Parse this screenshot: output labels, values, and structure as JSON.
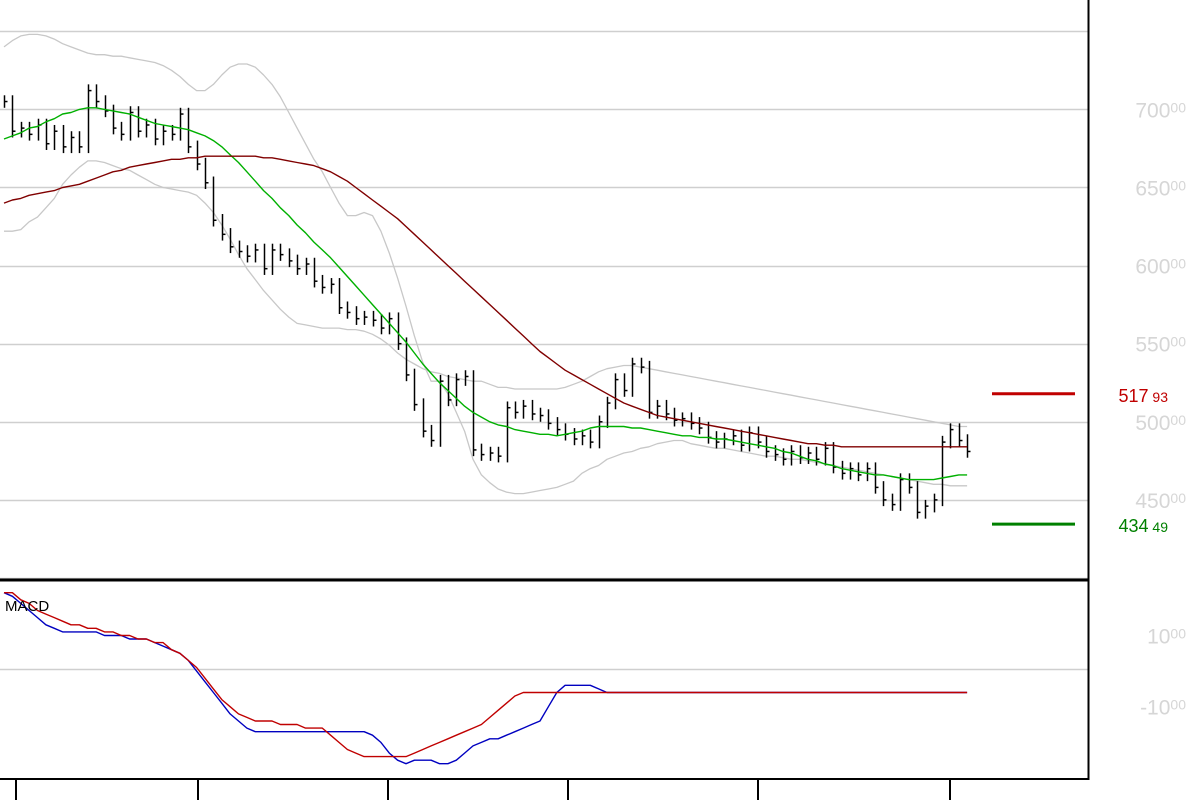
{
  "chart_data": [
    {
      "type": "ohlc",
      "y_ticks": [
        {
          "value": 450,
          "major": "450",
          "minor": "00"
        },
        {
          "value": 500,
          "major": "500",
          "minor": "00"
        },
        {
          "value": 550,
          "major": "550",
          "minor": "00"
        },
        {
          "value": 600,
          "major": "600",
          "minor": "00"
        },
        {
          "value": 650,
          "major": "650",
          "minor": "00"
        },
        {
          "value": 700,
          "major": "700",
          "minor": "00"
        }
      ],
      "ylim": [
        400,
        770
      ],
      "grid": true,
      "reference_lines": [
        {
          "value": 517.93,
          "major": "517",
          "minor": "93",
          "color": "#c00000"
        },
        {
          "value": 434.49,
          "major": "434",
          "minor": "49",
          "color": "#008000"
        }
      ],
      "closes": [
        705,
        686,
        688,
        684,
        690,
        678,
        686,
        676,
        682,
        676,
        712,
        705,
        699,
        688,
        684,
        698,
        686,
        690,
        681,
        686,
        684,
        697,
        676,
        665,
        653,
        629,
        620,
        612,
        609,
        606,
        610,
        598,
        610,
        607,
        603,
        598,
        601,
        590,
        586,
        588,
        573,
        570,
        566,
        567,
        565,
        560,
        566,
        550,
        530,
        511,
        494,
        488,
        526,
        514,
        527,
        529,
        482,
        479,
        480,
        478,
        509,
        506,
        510,
        505,
        504,
        499,
        495,
        492,
        489,
        491,
        487,
        500,
        512,
        527,
        520,
        537,
        535,
        506,
        510,
        505,
        501,
        502,
        499,
        496,
        490,
        487,
        489,
        491,
        485,
        493,
        487,
        481,
        479,
        476,
        481,
        477,
        480,
        476,
        483,
        471,
        467,
        470,
        466,
        470,
        458,
        450,
        447,
        463,
        458,
        442,
        446,
        450,
        487,
        495,
        488,
        481
      ],
      "series_lines": [
        {
          "name": "",
          "color": "#00b000",
          "values": [
            681,
            683,
            685,
            688,
            689,
            692,
            694,
            697,
            698,
            700,
            701,
            701,
            700,
            699,
            698,
            697,
            695,
            693,
            691,
            690,
            689,
            688,
            687,
            685,
            683,
            680,
            676,
            671,
            666,
            660,
            654,
            648,
            643,
            637,
            632,
            626,
            621,
            615,
            610,
            605,
            599,
            593,
            587,
            581,
            575,
            569,
            563,
            557,
            551,
            544,
            537,
            531,
            525,
            520,
            515,
            510,
            506,
            503,
            500,
            498,
            497,
            495,
            494,
            493,
            492,
            492,
            491,
            492,
            493,
            494,
            496,
            497,
            497,
            497,
            497,
            496,
            496,
            495,
            494,
            493,
            492,
            491,
            491,
            490,
            490,
            489,
            489,
            488,
            487,
            486,
            485,
            484,
            483,
            481,
            480,
            478,
            476,
            475,
            473,
            472,
            470,
            469,
            468,
            467,
            466,
            466,
            465,
            464,
            463,
            463,
            463,
            463,
            464,
            465,
            466,
            466
          ]
        },
        {
          "name": "",
          "color": "#800000",
          "values": [
            640,
            642,
            643,
            645,
            646,
            647,
            648,
            650,
            651,
            652,
            654,
            656,
            658,
            660,
            661,
            663,
            664,
            665,
            666,
            667,
            668,
            668,
            669,
            669,
            670,
            670,
            670,
            670,
            670,
            670,
            670,
            669,
            669,
            668,
            667,
            666,
            665,
            664,
            662,
            660,
            657,
            654,
            650,
            646,
            642,
            638,
            634,
            630,
            625,
            620,
            615,
            610,
            605,
            600,
            595,
            590,
            585,
            580,
            575,
            570,
            565,
            560,
            555,
            550,
            545,
            541,
            537,
            533,
            530,
            527,
            524,
            521,
            518,
            515,
            512,
            510,
            508,
            506,
            504,
            503,
            502,
            501,
            500,
            499,
            498,
            497,
            496,
            495,
            494,
            493,
            492,
            491,
            490,
            489,
            488,
            487,
            486,
            486,
            485,
            485,
            484,
            484,
            484,
            484,
            484,
            484,
            484,
            484,
            484,
            484,
            484,
            484,
            484,
            484,
            484,
            484
          ]
        },
        {
          "name": "",
          "color": "#c8c8c8",
          "values": [
            740,
            744,
            747,
            748,
            748,
            747,
            745,
            742,
            740,
            738,
            736,
            735,
            735,
            734,
            734,
            733,
            732,
            731,
            730,
            728,
            725,
            721,
            716,
            712,
            712,
            716,
            722,
            727,
            729,
            729,
            727,
            722,
            716,
            708,
            698,
            688,
            678,
            668,
            660,
            650,
            640,
            632,
            632,
            634,
            632,
            622,
            608,
            592,
            574,
            555,
            538,
            526,
            526,
            518,
            506,
            494,
            476,
            466,
            461,
            457,
            455,
            454,
            454,
            455,
            456,
            457,
            458,
            460,
            462,
            467,
            470,
            472,
            476,
            478,
            480,
            481,
            483,
            484,
            486,
            487,
            488,
            488,
            486,
            485,
            484,
            483,
            483,
            482,
            481,
            480,
            479,
            478,
            478,
            477,
            476,
            476,
            475,
            474,
            473,
            472,
            471,
            470,
            469,
            468,
            467,
            466,
            465,
            464,
            463,
            462,
            461,
            460,
            460,
            459,
            459,
            459
          ]
        },
        {
          "name": "",
          "color": "#c8c8c8",
          "values": [
            622,
            622,
            623,
            628,
            631,
            637,
            643,
            652,
            658,
            663,
            667,
            667,
            666,
            664,
            662,
            661,
            658,
            655,
            652,
            650,
            649,
            648,
            647,
            645,
            640,
            634,
            626,
            617,
            607,
            598,
            591,
            584,
            578,
            572,
            567,
            563,
            562,
            561,
            560,
            560,
            560,
            559,
            559,
            558,
            556,
            553,
            549,
            544,
            540,
            537,
            534,
            532,
            531,
            529,
            528,
            527,
            526,
            526,
            524,
            522,
            522,
            521,
            521,
            521,
            521,
            521,
            521,
            522,
            524,
            526,
            529,
            532,
            534,
            535,
            536,
            536,
            535,
            534,
            533,
            532,
            531,
            530,
            529,
            528,
            527,
            526,
            525,
            524,
            523,
            522,
            521,
            520,
            519,
            518,
            517,
            516,
            515,
            514,
            513,
            512,
            511,
            510,
            509,
            508,
            507,
            506,
            505,
            504,
            503,
            502,
            501,
            500,
            499,
            498,
            497,
            497
          ]
        }
      ]
    },
    {
      "type": "line",
      "title": "MACD",
      "y_ticks": [
        {
          "value": 10,
          "major": "10",
          "minor": "00"
        },
        {
          "value": -10,
          "major": "-10",
          "minor": "00"
        }
      ],
      "ylim": [
        -30,
        25
      ],
      "series": [
        {
          "name": "",
          "color": "#0000c0",
          "values": [
            22,
            21,
            19,
            17,
            15,
            13,
            12,
            11,
            11,
            11,
            11,
            11,
            10,
            10,
            10,
            9,
            9,
            9,
            8,
            7,
            6,
            5,
            3,
            0,
            -3,
            -6,
            -9,
            -12,
            -14,
            -16,
            -17,
            -17,
            -17,
            -17,
            -17,
            -17,
            -17,
            -17,
            -17,
            -17,
            -17,
            -17,
            -17,
            -17,
            -18,
            -20,
            -23,
            -25,
            -26,
            -25,
            -25,
            -25,
            -26,
            -26,
            -25,
            -23,
            -21,
            -20,
            -19,
            -19,
            -18,
            -17,
            -16,
            -15,
            -14,
            -10,
            -6,
            -4,
            -4,
            -4,
            -4,
            -5,
            -6,
            -6,
            -6,
            -6,
            -6,
            -6,
            -6,
            -6,
            -6,
            -6,
            -6,
            -6,
            -6,
            -6,
            -6,
            -6,
            -6,
            -6,
            -6,
            -6,
            -6,
            -6,
            -6,
            -6,
            -6,
            -6,
            -6,
            -6,
            -6,
            -6,
            -6,
            -6,
            -6,
            -6,
            -6,
            -6,
            -6,
            -6,
            -6,
            -6,
            -6,
            -6,
            -6,
            -6
          ]
        },
        {
          "name": "",
          "color": "#c00000",
          "values": [
            22,
            22,
            20,
            19,
            17,
            16,
            15,
            14,
            13,
            13,
            12,
            12,
            11,
            11,
            10,
            10,
            9,
            9,
            8,
            8,
            6,
            5,
            3,
            1,
            -2,
            -5,
            -8,
            -10,
            -12,
            -13,
            -14,
            -14,
            -14,
            -15,
            -15,
            -15,
            -16,
            -16,
            -16,
            -18,
            -20,
            -22,
            -23,
            -24,
            -24,
            -24,
            -24,
            -24,
            -24,
            -23,
            -22,
            -21,
            -20,
            -19,
            -18,
            -17,
            -16,
            -15,
            -13,
            -11,
            -9,
            -7,
            -6,
            -6,
            -6,
            -6,
            -6,
            -6,
            -6,
            -6,
            -6,
            -6,
            -6,
            -6,
            -6,
            -6,
            -6,
            -6,
            -6,
            -6,
            -6,
            -6,
            -6,
            -6,
            -6,
            -6,
            -6,
            -6,
            -6,
            -6,
            -6,
            -6,
            -6,
            -6,
            -6,
            -6,
            -6,
            -6,
            -6,
            -6,
            -6,
            -6,
            -6,
            -6,
            -6,
            -6,
            -6,
            -6,
            -6,
            -6,
            -6,
            -6,
            -6,
            -6,
            -6,
            -6
          ]
        }
      ]
    }
  ]
}
